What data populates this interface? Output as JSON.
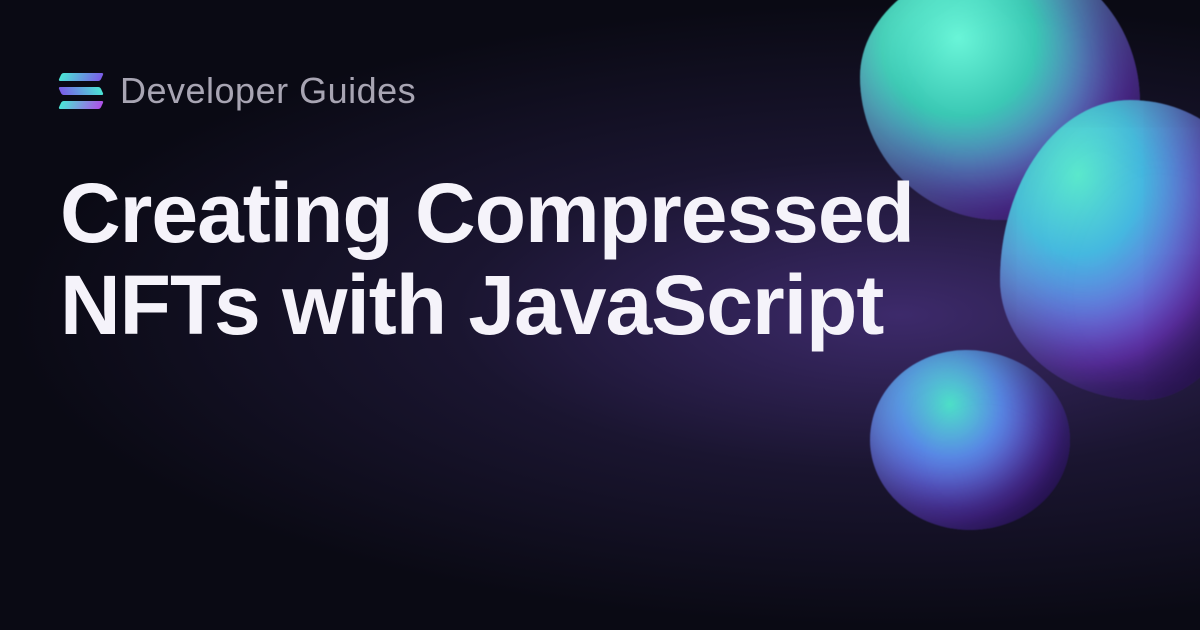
{
  "header": {
    "section": "Developer Guides"
  },
  "title": "Creating Compressed NFTs with JavaScript"
}
